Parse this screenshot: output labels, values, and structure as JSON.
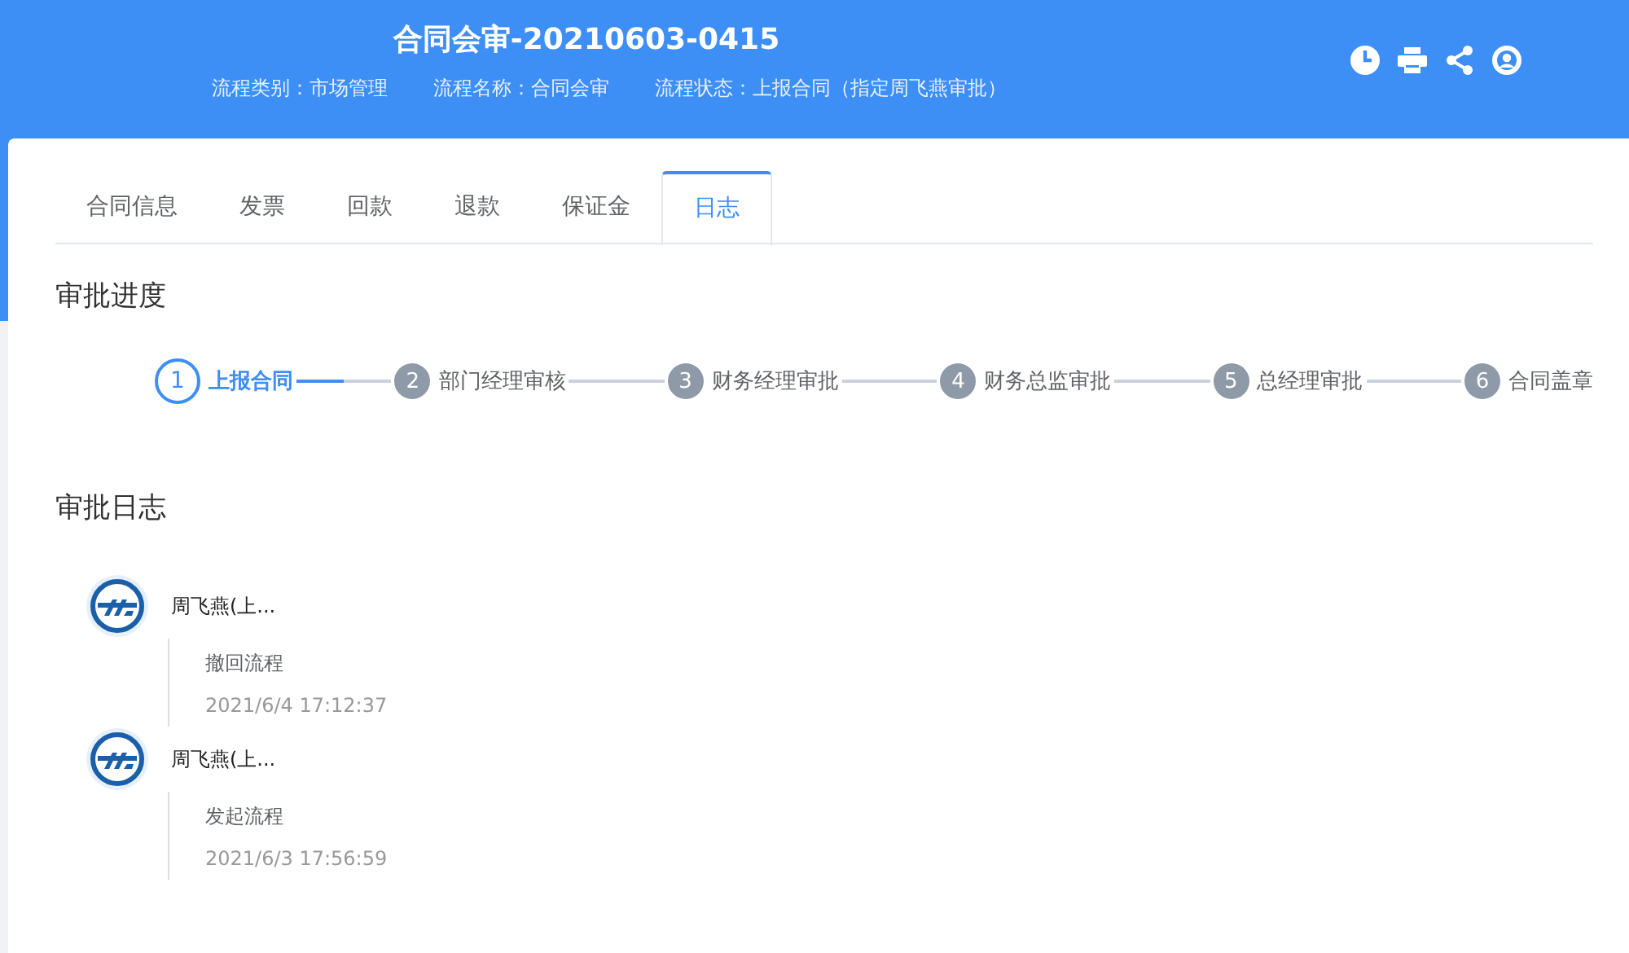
{
  "header": {
    "title": "合同会审-20210603-0415",
    "meta": [
      "流程类别：市场管理",
      "流程名称：合同会审",
      "流程状态：上报合同（指定周飞燕审批）"
    ]
  },
  "tabs": [
    {
      "label": "合同信息",
      "selected": false
    },
    {
      "label": "发票",
      "selected": false
    },
    {
      "label": "回款",
      "selected": false
    },
    {
      "label": "退款",
      "selected": false
    },
    {
      "label": "保证金",
      "selected": false
    },
    {
      "label": "日志",
      "selected": true
    }
  ],
  "progress": {
    "heading": "审批进度",
    "steps": [
      {
        "number": "1",
        "label": "上报合同",
        "active": true
      },
      {
        "number": "2",
        "label": "部门经理审核",
        "active": false
      },
      {
        "number": "3",
        "label": "财务经理审批",
        "active": false
      },
      {
        "number": "4",
        "label": "财务总监审批",
        "active": false
      },
      {
        "number": "5",
        "label": "总经理审批",
        "active": false
      },
      {
        "number": "6",
        "label": "合同盖章",
        "active": false
      }
    ]
  },
  "log": {
    "heading": "审批日志",
    "entries": [
      {
        "user": "周飞燕(上...",
        "action": "撤回流程",
        "time": "2021/6/4 17:12:37"
      },
      {
        "user": "周飞燕(上...",
        "action": "发起流程",
        "time": "2021/6/3 17:56:59"
      }
    ]
  }
}
